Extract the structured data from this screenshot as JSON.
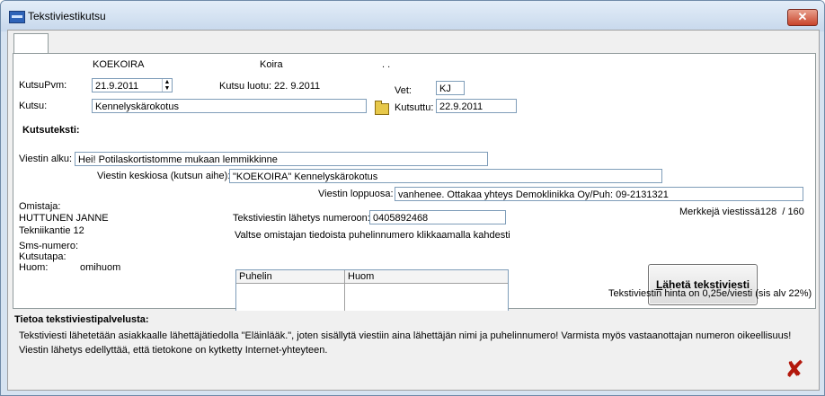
{
  "window": {
    "title": "Tekstiviestikutsu",
    "close_glyph": "✕"
  },
  "header": {
    "name": "KOEKOIRA",
    "species": "Koira",
    "extra": ". ."
  },
  "form": {
    "kutsupvm_label": "KutsuPvm:",
    "kutsupvm_value": "21.9.2011",
    "kutsu_luotu_label": "Kutsu luotu:",
    "kutsu_luotu_value": "22. 9.2011",
    "vet_label": "Vet:",
    "vet_value": "KJ",
    "kutsu_label": "Kutsu:",
    "kutsu_value": "Kennelyskärokotus",
    "kutsuttu_label": "Kutsuttu:",
    "kutsuttu_value": "22.9.2011"
  },
  "message": {
    "section_title": "Kutsuteksti:",
    "start_label": "Viestin alku:",
    "start_value": "Hei! Potilaskortistomme mukaan lemmikkinne",
    "middle_label": "Viestin keskiosa (kutsun aihe):",
    "middle_value": "\"KOEKOIRA\" Kennelyskärokotus",
    "end_label": "Viestin loppuosa:",
    "end_value": "vanhenee. Ottakaa yhteys  Demoklinikka Oy/Puh: 09-2131321",
    "char_count_label": "Merkkejä viestissä",
    "char_count": "128",
    "char_max": "/ 160"
  },
  "owner": {
    "label": "Omistaja:",
    "name": "HUTTUNEN JANNE",
    "address": "Tekniikantie 12",
    "sms_label": "Sms-numero:",
    "kutsutapa_label": "Kutsutapa:",
    "huom_label": "Huom:",
    "huom_value": "omihuom"
  },
  "send": {
    "number_label": "Tekstiviestin lähetys numeroon:",
    "number_value": "0405892468",
    "select_hint": "Valtse omistajan tiedoista puhelinnumero klikkaamalla kahdesti",
    "grid_columns": [
      "Puhelin",
      "Huom"
    ],
    "button_mnemonic": "L",
    "button_rest": "ähetä tekstiviesti",
    "price_text": "Tekstiviestin hinta on 0,25e/viesti (sis alv 22%)"
  },
  "info": {
    "title": "Tietoa tekstiviestipalvelusta:",
    "line1": "Tekstiviesti lähetetään asiakkaalle lähettäjätiedolla \"Eläinlääk.\", joten sisällytä viestiin aina lähettäjän nimi ja puhelinnumero! Varmista myös vastaanottajan numeron oikeellisuus!",
    "line2": "Viestin lähetys edellyttää, että tietokone on kytketty Internet-yhteyteen."
  },
  "icons": {
    "close": "close-icon",
    "exit": "exit-icon",
    "folder": "folder-icon",
    "exit_color": "#b3180c"
  }
}
